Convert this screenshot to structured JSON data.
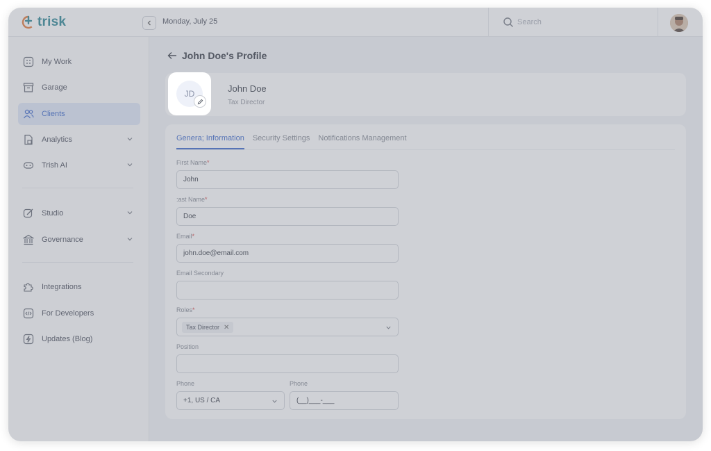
{
  "app": {
    "brand": "trisk",
    "brand_color": "#1f7f8d",
    "accent": "#3160c8"
  },
  "header": {
    "date": "Monday, July 25",
    "search_placeholder": "Search"
  },
  "sidebar": {
    "items": [
      {
        "label": "My Work",
        "icon": "grid-icon"
      },
      {
        "label": "Garage",
        "icon": "archive-icon"
      },
      {
        "label": "Clients",
        "icon": "users-icon",
        "active": true
      },
      {
        "label": "Analytics",
        "icon": "analytics-doc-icon",
        "expandable": true
      },
      {
        "label": "Trish AI",
        "icon": "robot-icon",
        "expandable": true
      },
      {
        "label": "Studio",
        "icon": "edit-square-icon",
        "expandable": true
      },
      {
        "label": "Governance",
        "icon": "bank-icon",
        "expandable": true
      },
      {
        "label": "Integrations",
        "icon": "puzzle-icon"
      },
      {
        "label": "For Developers",
        "icon": "code-icon"
      },
      {
        "label": "Updates (Blog)",
        "icon": "lightning-icon"
      }
    ]
  },
  "main": {
    "title": "John Doe's Profile",
    "profile": {
      "initials": "JD",
      "name": "John Doe",
      "role": "Tax Director"
    },
    "tabs": [
      "Genera; Information",
      "Security Settings",
      "Notifications Management"
    ],
    "form": {
      "first_name": {
        "label": "First Name",
        "value": "John"
      },
      "last_name": {
        "label": ":ast Name",
        "value": "Doe"
      },
      "email": {
        "label": "Email",
        "value": "john.doe@email.com"
      },
      "email_secondary": {
        "label": "Email Secondary",
        "value": ""
      },
      "roles": {
        "label": "Roles",
        "chip": "Tax Director",
        "chip_remove": "✕"
      },
      "position": {
        "label": "Position",
        "value": ""
      },
      "phone_code": {
        "label": "Phone",
        "value": "+1, US / CA"
      },
      "phone_number": {
        "label": "Phone",
        "value": "(__)___-___"
      }
    },
    "required_mark": "*"
  }
}
